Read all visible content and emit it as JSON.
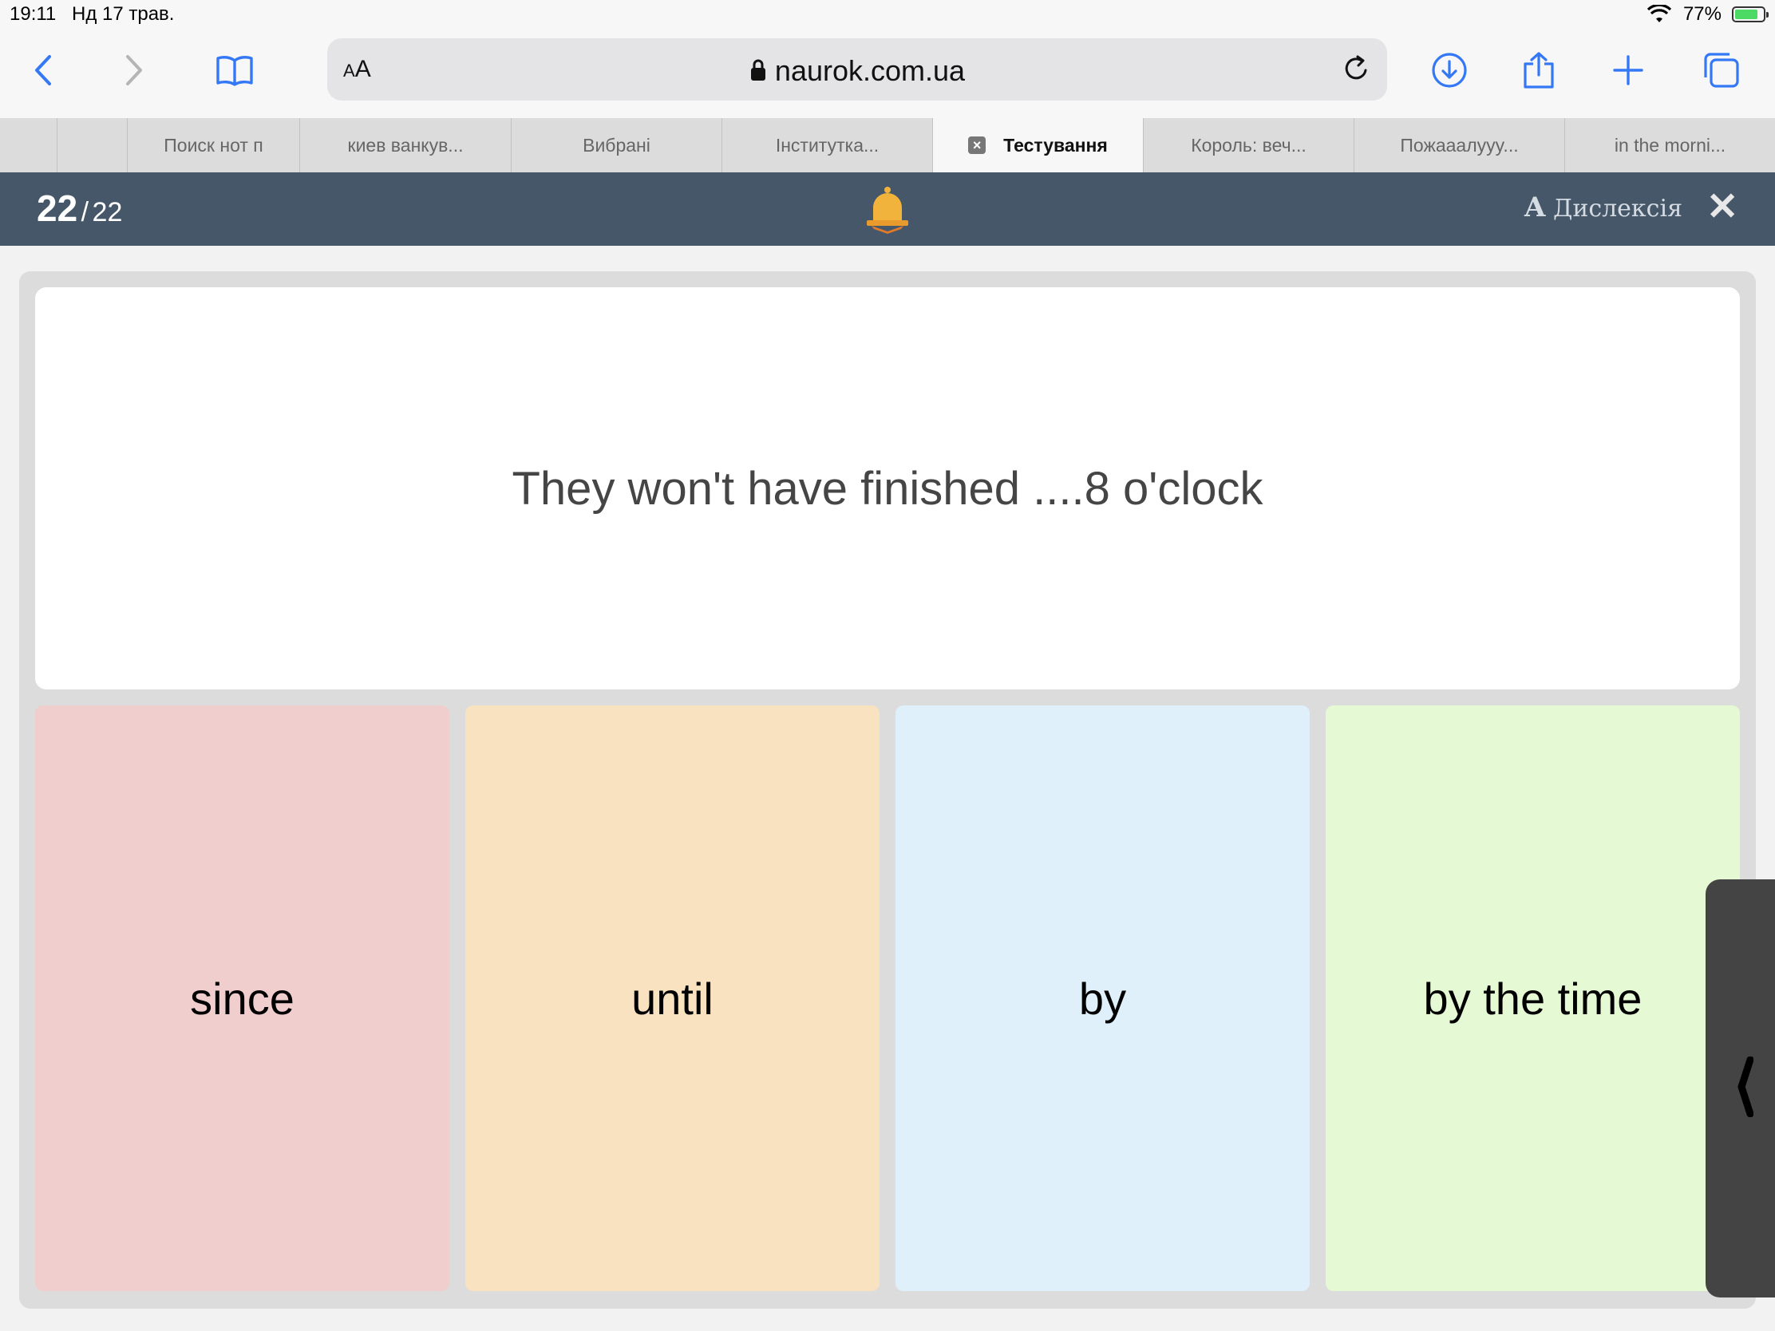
{
  "status": {
    "time": "19:11",
    "date": "Нд 17 трав.",
    "battery": "77%"
  },
  "browser": {
    "aa_small": "A",
    "aa_big": "A",
    "url": "naurok.com.ua",
    "tabs": [
      {
        "label": "",
        "active": false
      },
      {
        "label": "",
        "active": false
      },
      {
        "label": "Поиск нот п",
        "active": false
      },
      {
        "label": "киев ванкув...",
        "active": false
      },
      {
        "label": "Вибрані",
        "active": false
      },
      {
        "label": "Інститутка...",
        "active": false
      },
      {
        "label": "Тестування",
        "active": true
      },
      {
        "label": "Король: веч...",
        "active": false
      },
      {
        "label": "Пожааалуyy...",
        "active": false
      },
      {
        "label": "in the morni...",
        "active": false
      }
    ]
  },
  "quiz": {
    "current": "22",
    "separator": "/",
    "total": "22",
    "dyslexia_big": "A",
    "dyslexia_label": "Дислексія",
    "question": "They won't have finished ....8 o'clock",
    "answers": [
      {
        "text": "since",
        "color": "#f0cece"
      },
      {
        "text": "until",
        "color": "#f8e2bf"
      },
      {
        "text": "by",
        "color": "#dff0fa"
      },
      {
        "text": "by the time",
        "color": "#e5fad4"
      }
    ]
  },
  "colors": {
    "header": "#46576a",
    "accent": "#3478f6",
    "bell": "#f2b33d"
  }
}
